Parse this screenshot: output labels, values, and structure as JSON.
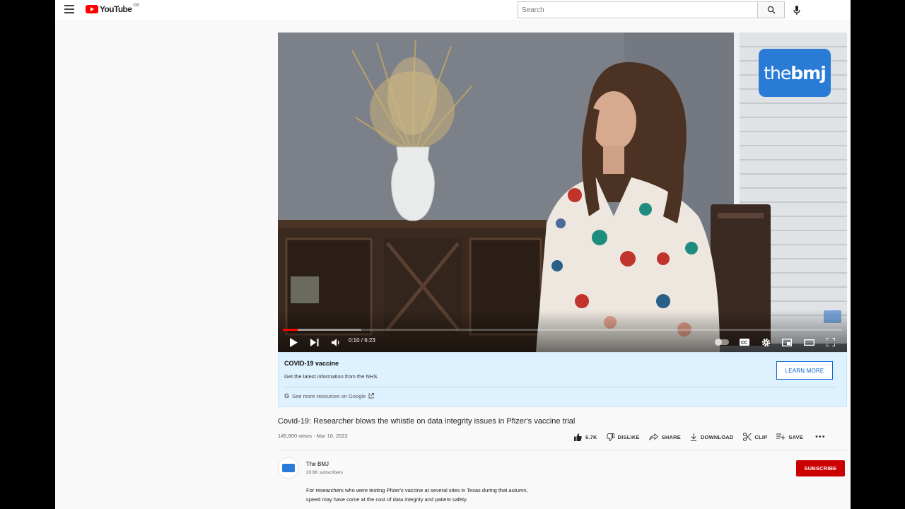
{
  "header": {
    "logo_text": "YouTube",
    "logo_region": "GB",
    "search_placeholder": "Search"
  },
  "player": {
    "overlay_logo_light": "the",
    "overlay_logo_bold": "bmj",
    "time_display": "0:10 / 6:23",
    "progress_played_fraction": 0.026,
    "progress_buffered_fraction": 0.14
  },
  "info_panel": {
    "title": "COVID-19 vaccine",
    "subtitle": "Get the latest information from the NHS.",
    "button_label": "LEARN MORE",
    "link_text": "See more resources on Google"
  },
  "video": {
    "title": "Covid-19: Researcher blows the whistle on data integrity issues in Pfizer's vaccine trial",
    "meta": "145,800 views · Mar 16, 2022",
    "actions": {
      "like": "6.7K",
      "dislike": "DISLIKE",
      "share": "SHARE",
      "download": "DOWNLOAD",
      "clip": "CLIP",
      "save": "SAVE",
      "more": "•••"
    }
  },
  "channel": {
    "name": "The BMJ",
    "subscribers": "20.6K subscribers",
    "subscribe_label": "SUBSCRIBE",
    "description_line1": "For researchers who were testing Pfizer's vaccine at several sites in Texas during that autumn,",
    "description_line2": "speed may have come at the cost of data integrity and patient safety."
  },
  "colors": {
    "brand_red": "#ff0000",
    "subscribe_red": "#cc0000",
    "bmj_blue": "#2a7bd6",
    "link_blue": "#065fd4",
    "info_bg": "#def1fe"
  },
  "icons": [
    "menu-icon",
    "youtube-logo",
    "search-icon",
    "mic-icon",
    "play-icon",
    "next-icon",
    "volume-icon",
    "captions-icon",
    "settings-icon",
    "miniplayer-icon",
    "theater-icon",
    "fullscreen-icon",
    "google-icon",
    "external-link-icon",
    "like-icon",
    "dislike-icon",
    "share-icon",
    "download-icon",
    "clip-icon",
    "save-icon"
  ]
}
